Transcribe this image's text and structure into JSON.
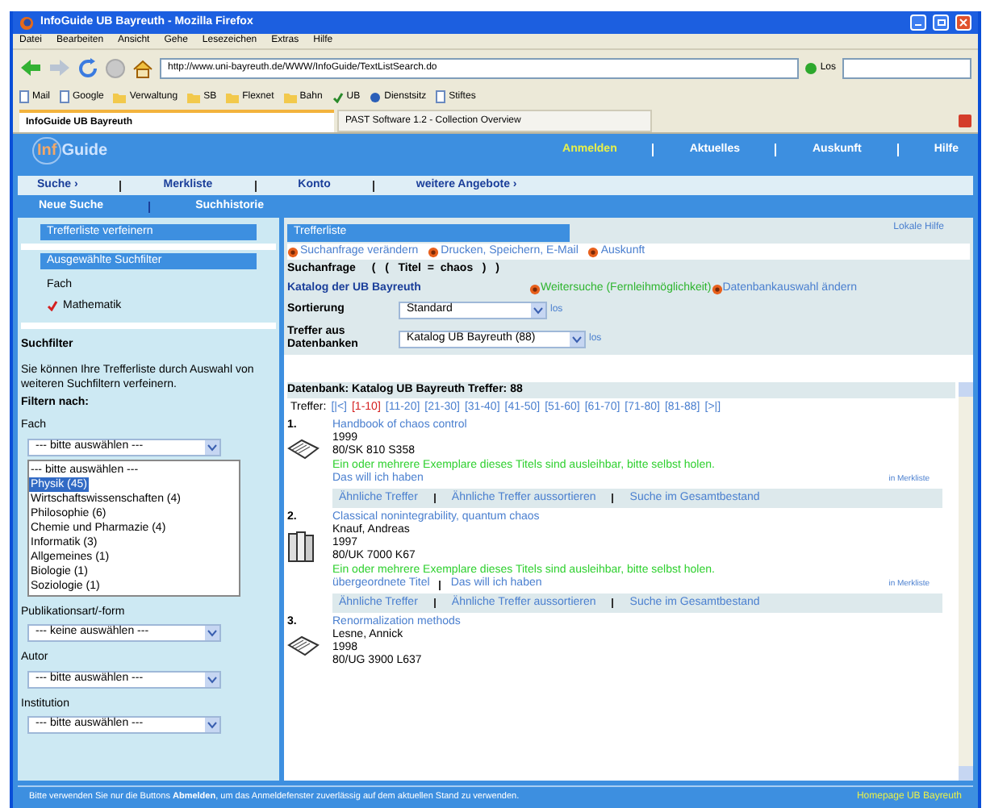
{
  "window": {
    "title": "InfoGuide UB Bayreuth - Mozilla Firefox"
  },
  "menu": [
    "Datei",
    "Bearbeiten",
    "Ansicht",
    "Gehe",
    "Lesezeichen",
    "Extras",
    "Hilfe"
  ],
  "toolbar": {
    "url": "http://www.uni-bayreuth.de/WWW/InfoGuide/TextListSearch.do",
    "go": "Los"
  },
  "bookmarks": [
    {
      "label": "Mail",
      "kind": "page"
    },
    {
      "label": "Google",
      "kind": "page"
    },
    {
      "label": "Verwaltung",
      "kind": "folder"
    },
    {
      "label": "SB",
      "kind": "folder"
    },
    {
      "label": "Flexnet",
      "kind": "folder"
    },
    {
      "label": "Bahn",
      "kind": "folder"
    },
    {
      "label": "UB",
      "kind": "check"
    },
    {
      "label": "Dienstsitz",
      "kind": "globe"
    },
    {
      "label": "Stiftes",
      "kind": "page"
    }
  ],
  "tabs": [
    {
      "label": "InfoGuide UB Bayreuth",
      "selected": true
    },
    {
      "label": "PAST Software 1.2 - Collection Overview",
      "selected": false
    }
  ],
  "header": {
    "logo_a": "Inf",
    "logo_b": "Guide",
    "links": [
      {
        "label": "Anmelden",
        "selected": true
      },
      {
        "label": "Aktuelles",
        "selected": false
      },
      {
        "label": "Auskunft",
        "selected": false
      },
      {
        "label": "Hilfe",
        "selected": false
      }
    ]
  },
  "nav": {
    "primary": [
      "Suche ›",
      "Merkliste",
      "Konto",
      "weitere Angebote ›"
    ],
    "secondary": [
      "Neue Suche",
      "Suchhistorie"
    ]
  },
  "sidebar": {
    "refine": "Trefferliste verfeinern",
    "chosen": "Ausgewählte Suchfilter",
    "chosen_group": "Fach",
    "chosen_filters": [
      {
        "label": "Mathematik",
        "checked": true
      }
    ],
    "filter_title": "Suchfilter",
    "filter_text": "Sie können Ihre Trefferliste durch Auswahl von weiteren Suchfiltern verfeinern.",
    "filter_by": "Filtern nach:",
    "subject": {
      "label": "Fach",
      "value": "--- bitte auswählen ---",
      "options": [
        {
          "label": "--- bitte auswählen ---",
          "highlighted": false
        },
        {
          "label": "Physik (45)",
          "highlighted": true
        },
        {
          "label": "Wirtschaftswissenschaften (4)",
          "highlighted": false
        },
        {
          "label": "Philosophie (6)",
          "highlighted": false
        },
        {
          "label": "Chemie und Pharmazie (4)",
          "highlighted": false
        },
        {
          "label": "Informatik (3)",
          "highlighted": false
        },
        {
          "label": "Allgemeines (1)",
          "highlighted": false
        },
        {
          "label": "Biologie (1)",
          "highlighted": false
        },
        {
          "label": "Soziologie (1)",
          "highlighted": false
        }
      ]
    },
    "selects": [
      {
        "label": "Publikationsart/-form",
        "value": "--- keine auswählen ---"
      },
      {
        "label": "Autor",
        "value": "--- bitte auswählen ---"
      },
      {
        "label": "Institution",
        "value": "--- bitte auswählen ---"
      }
    ]
  },
  "results": {
    "help": "Lokale Hilfe",
    "title": "Trefferliste",
    "actions": [
      "Suchanfrage verändern",
      "Drucken, Speichern, E-Mail",
      "Auskunft"
    ],
    "query_label": "Suchanfrage",
    "query": "(   (   Titel  =  chaos   )   )",
    "catalog": "Katalog der UB Bayreuth",
    "further": "Weitersuche (Fernleihmöglichkeit)",
    "change_db": "Datenbankauswahl ändern",
    "sort_label": "Sortierung",
    "sort_value": "Standard",
    "sort_go": "los",
    "db_label": "Treffer aus Datenbanken",
    "db_value": "Katalog UB Bayreuth (88)",
    "db_go": "los",
    "summary": "Datenbank: Katalog UB Bayreuth Treffer: 88",
    "pages_label": "Treffer:",
    "pages": [
      {
        "label": "[|<]",
        "selected": false
      },
      {
        "label": "[1-10]",
        "selected": true
      },
      {
        "label": "[11-20]",
        "selected": false
      },
      {
        "label": "[21-30]",
        "selected": false
      },
      {
        "label": "[31-40]",
        "selected": false
      },
      {
        "label": "[41-50]",
        "selected": false
      },
      {
        "label": "[51-60]",
        "selected": false
      },
      {
        "label": "[61-70]",
        "selected": false
      },
      {
        "label": "[71-80]",
        "selected": false
      },
      {
        "label": "[81-88]",
        "selected": false
      },
      {
        "label": "[>|]",
        "selected": false
      }
    ],
    "records": [
      {
        "number": "1.",
        "kind": "book",
        "title": "Handbook of chaos control",
        "lines": [
          "1999",
          "80/SK 810 S358"
        ],
        "status": "Ein oder mehrere Exemplare dieses Titels sind ausleihbar, bitte selbst holen.",
        "links": [
          "Das will ich haben"
        ],
        "merk": "in Merkliste",
        "tools": [
          "Ähnliche Treffer",
          "Ähnliche Treffer aussortieren",
          "Suche im Gesamtbestand"
        ]
      },
      {
        "number": "2.",
        "kind": "series",
        "title": "Classical nonintegrability, quantum chaos",
        "lines": [
          "Knauf, Andreas",
          "1997",
          "80/UK 7000 K67"
        ],
        "status": "Ein oder mehrere Exemplare dieses Titels sind ausleihbar, bitte selbst holen.",
        "links": [
          "übergeordnete Titel",
          "Das will ich haben"
        ],
        "merk": "in Merkliste",
        "tools": [
          "Ähnliche Treffer",
          "Ähnliche Treffer aussortieren",
          "Suche im Gesamtbestand"
        ]
      },
      {
        "number": "3.",
        "kind": "book",
        "title": "Renormalization methods",
        "lines": [
          "Lesne, Annick",
          "1998",
          "80/UG 3900 L637"
        ]
      }
    ]
  },
  "footer": {
    "text": "Bitte verwenden Sie nur die Buttons **Abmelden**, um das Anmeldefenster zuverlässig auf dem aktuellen Stand zu verwenden.",
    "home": "Homepage UB Bayreuth"
  }
}
